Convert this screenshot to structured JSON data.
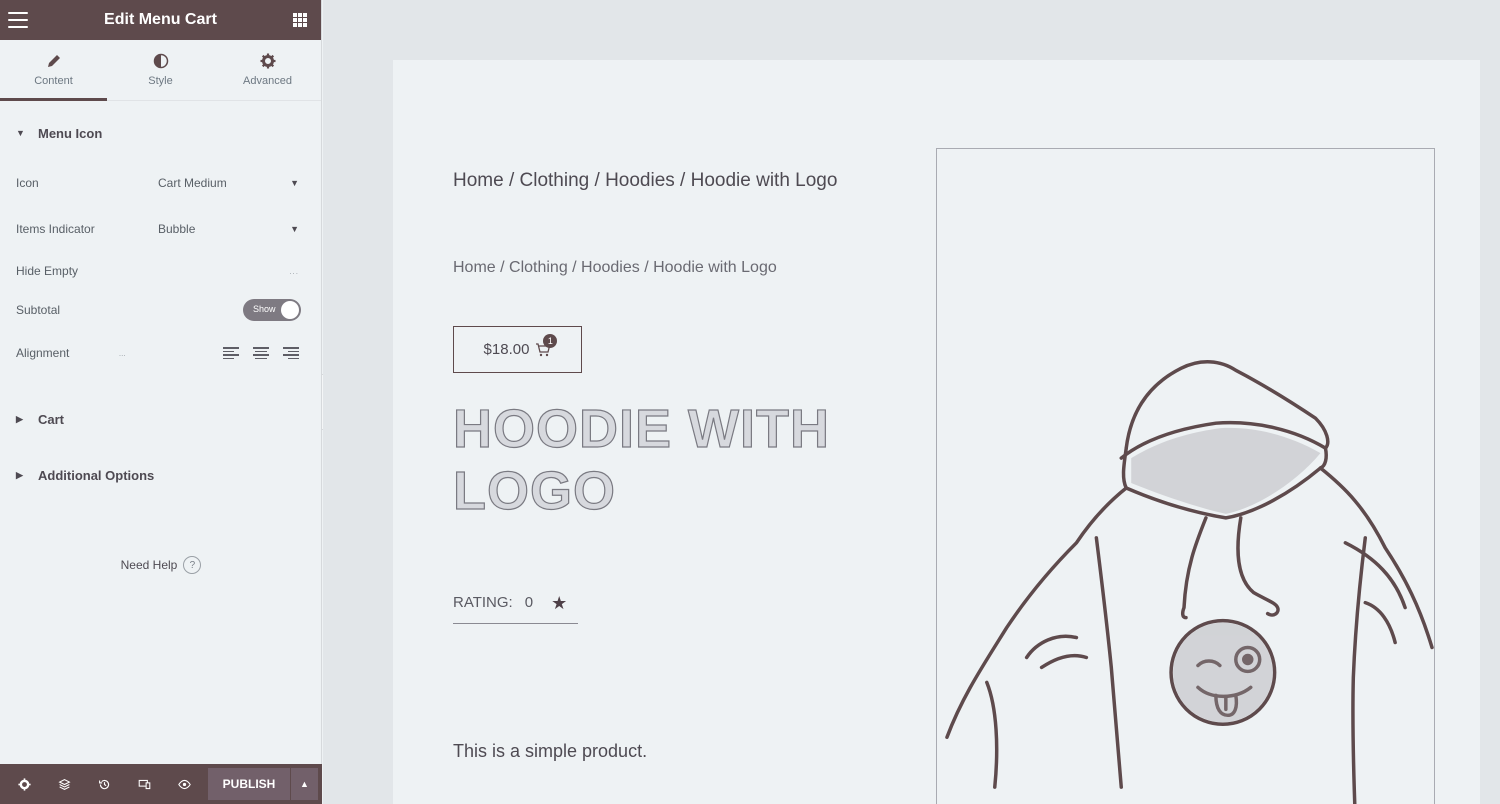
{
  "panel": {
    "title": "Edit Menu Cart",
    "tabs": [
      {
        "label": "Content",
        "icon": "pencil-icon"
      },
      {
        "label": "Style",
        "icon": "half-circle-icon"
      },
      {
        "label": "Advanced",
        "icon": "gear-icon"
      }
    ],
    "sections": {
      "menu_icon": "Menu Icon",
      "cart": "Cart",
      "additional": "Additional Options"
    },
    "controls": {
      "icon_label": "Icon",
      "icon_value": "Cart Medium",
      "indicator_label": "Items Indicator",
      "indicator_value": "Bubble",
      "hide_empty_label": "Hide Empty",
      "hide_empty_state": "...",
      "subtotal_label": "Subtotal",
      "subtotal_state": "Show",
      "alignment_label": "Alignment",
      "alignment_extra": "..."
    },
    "help": {
      "label": "Need Help",
      "icon_char": "?"
    },
    "footer": {
      "publish": "PUBLISH"
    }
  },
  "preview": {
    "breadcrumb_primary": "Home / Clothing / Hoodies / Hoodie with Logo",
    "breadcrumb_secondary": "Home / Clothing / Hoodies / Hoodie with Logo",
    "cart": {
      "price": "$18.00",
      "count": "1"
    },
    "product_title": "HOODIE WITH LOGO",
    "rating": {
      "label": "RATING:",
      "value": "0"
    },
    "description": "This is a simple product."
  },
  "colors": {
    "accent": "#5e4a4c",
    "panel_bg": "#eef2f4",
    "canvas_bg": "#e2e6e9"
  }
}
